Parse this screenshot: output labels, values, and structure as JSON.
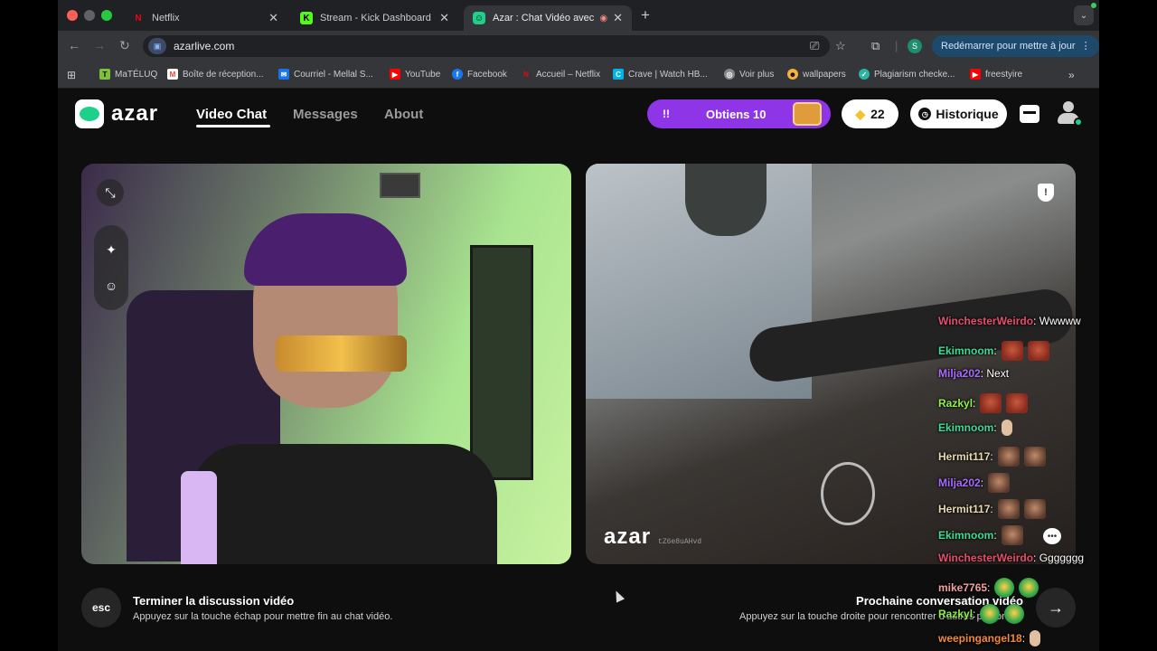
{
  "browser": {
    "tabs": [
      {
        "title": "Netflix",
        "icon": "netflix-icon"
      },
      {
        "title": "Stream - Kick Dashboard",
        "icon": "kick-icon"
      },
      {
        "title": "Azar : Chat Vidéo avec de",
        "icon": "azar-icon"
      }
    ],
    "url": "azarlive.com",
    "update_button": "Redémarrer pour mettre à jour",
    "profile_initial": "S",
    "bookmarks": [
      "MaTÉLUQ",
      "Boîte de réception...",
      "Courriel - Mellal S...",
      "YouTube",
      "Facebook",
      "Accueil – Netflix",
      "Crave | Watch HB...",
      "Voir plus",
      "wallpapers",
      "Plagiarism checke...",
      "freestyire"
    ],
    "more_bookmarks": "»"
  },
  "header": {
    "logo_text": "azar",
    "nav": [
      "Video Chat",
      "Messages",
      "About"
    ],
    "promo_exclaim": "!!",
    "promo_label": "Obtiens 10",
    "gems_count": "22",
    "history_label": "Historique"
  },
  "videos": {
    "watermark": "azar",
    "watermark_id": "tZ6e8uAHvd"
  },
  "bottom": {
    "esc_key": "esc",
    "end_title": "Terminer la discussion vidéo",
    "end_sub": "Appuyez sur la touche échap pour mettre fin au chat vidéo.",
    "next_title": "Prochaine conversation vidéo",
    "next_sub": "Appuyez sur la touche droite pour rencontrer d'autres personnes",
    "next_arrow": "→"
  },
  "chat": {
    "messages": [
      {
        "user": "WinchesterWeirdo",
        "color": "#e84e6c",
        "text": ": Wwwww",
        "emotes": []
      },
      {
        "user": "Ekimnoom",
        "color": "#3ddc97",
        "text": ":",
        "emotes": [
          "red",
          "red"
        ]
      },
      {
        "user": "Milja202",
        "color": "#a86bff",
        "text": ": Next",
        "emotes": []
      },
      {
        "user": "Razkyl",
        "color": "#8ef04a",
        "text": ":",
        "emotes": [
          "red",
          "red"
        ]
      },
      {
        "user": "Ekimnoom",
        "color": "#3ddc97",
        "text": ":",
        "emotes": [
          "small"
        ]
      },
      {
        "user": "Hermit117",
        "color": "#e8d9b0",
        "text": ":",
        "emotes": [
          "face",
          "face"
        ]
      },
      {
        "user": "Milja202",
        "color": "#a86bff",
        "text": ":",
        "emotes": [
          "face"
        ]
      },
      {
        "user": "Hermit117",
        "color": "#e8d9b0",
        "text": ":",
        "emotes": [
          "face",
          "face"
        ]
      },
      {
        "user": "Ekimnoom",
        "color": "#3ddc97",
        "text": ":",
        "emotes": [
          "face"
        ]
      },
      {
        "user": "WinchesterWeirdo",
        "color": "#e84e6c",
        "text": ": Ggggggg",
        "emotes": []
      },
      {
        "user": "mike7765",
        "color": "#f0a0a0",
        "text": ":",
        "emotes": [
          "green",
          "green"
        ]
      },
      {
        "user": "Razkyl",
        "color": "#8ef04a",
        "text": ":",
        "emotes": [
          "green",
          "green"
        ]
      },
      {
        "user": "weepingangel18",
        "color": "#f08a3a",
        "text": ":",
        "emotes": [
          "small"
        ]
      }
    ]
  }
}
